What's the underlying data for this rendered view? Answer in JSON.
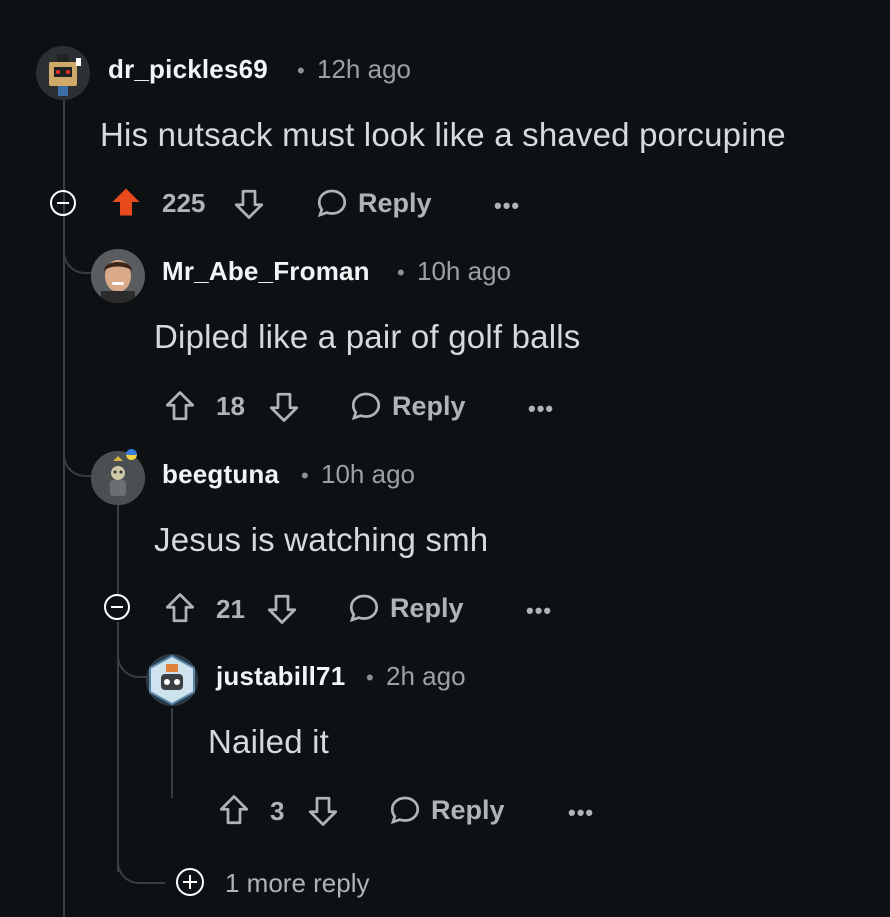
{
  "comments": [
    {
      "username": "dr_pickles69",
      "separator": "•",
      "time": "12h ago",
      "text": "His nutsack must look like a shaved porcupine",
      "votes": "225",
      "upvoted": true,
      "reply_label": "Reply",
      "more_label": "•••"
    },
    {
      "username": "Mr_Abe_Froman",
      "separator": "•",
      "time": "10h ago",
      "text": "Dipled like a pair of golf balls",
      "votes": "18",
      "upvoted": false,
      "reply_label": "Reply",
      "more_label": "•••"
    },
    {
      "username": "beegtuna",
      "separator": "•",
      "time": "10h ago",
      "text": "Jesus is watching smh",
      "votes": "21",
      "upvoted": false,
      "reply_label": "Reply",
      "more_label": "•••"
    },
    {
      "username": "justabill71",
      "separator": "•",
      "time": "2h ago",
      "text": "Nailed it",
      "votes": "3",
      "upvoted": false,
      "reply_label": "Reply",
      "more_label": "•••"
    }
  ],
  "more_replies_label": "1 more reply",
  "colors": {
    "background": "#0e1113",
    "upvote_active": "#e8491d",
    "text": "#d7dadc",
    "muted": "#9aa1a5"
  }
}
